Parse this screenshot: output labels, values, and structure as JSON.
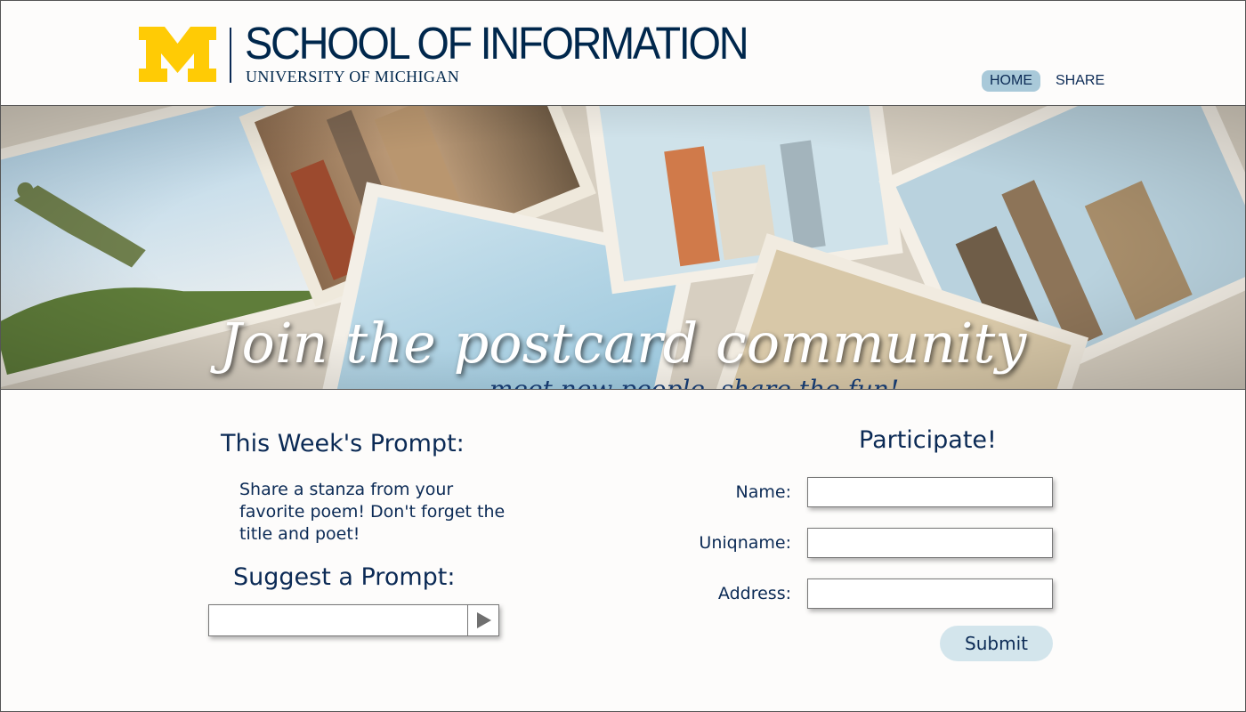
{
  "header": {
    "logo_letter": "M",
    "school_title": "SCHOOL OF INFORMATION",
    "university_title": "UNIVERSITY OF MICHIGAN",
    "brand_color": "#00274c",
    "logo_color": "#ffcb05"
  },
  "nav": {
    "items": [
      {
        "label": "HOME",
        "active": true
      },
      {
        "label": "SHARE",
        "active": false
      }
    ],
    "active_color": "#a9c9d9"
  },
  "banner": {
    "title": "Join the postcard community",
    "subtitle": "meet new people, share the fun!"
  },
  "prompt": {
    "heading": "This Week's Prompt:",
    "text": "Share a stanza from your favorite poem! Don't forget the title and poet!"
  },
  "suggest": {
    "heading": "Suggest a Prompt:",
    "value": "",
    "submit_icon": "play-arrow-icon"
  },
  "participate": {
    "heading": "Participate!",
    "fields": [
      {
        "label": "Name:",
        "value": ""
      },
      {
        "label": "Uniqname:",
        "value": ""
      },
      {
        "label": "Address:",
        "value": ""
      }
    ],
    "submit_label": "Submit",
    "submit_color": "#d3e5ec"
  }
}
